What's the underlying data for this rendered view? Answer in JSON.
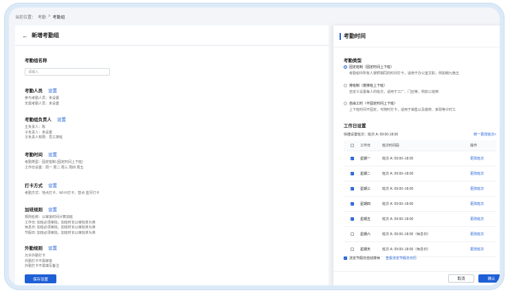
{
  "breadcrumb": {
    "prefix": "当前位置：",
    "items": [
      "考勤",
      "考勤组"
    ],
    "sep": ">"
  },
  "left": {
    "title": "新增考勤组",
    "name_label": "考勤组名称",
    "name_placeholder": "请输入",
    "sections": [
      {
        "title": "考勤人员",
        "link": "设置",
        "lines": [
          "参与考勤人员：未设置",
          "无需考勤人员：未设置"
        ]
      },
      {
        "title": "考勤组负责人",
        "link": "设置",
        "lines": [
          "主负责人：陈",
          "子负责人：未设置",
          "子负责人权限：员工排班"
        ]
      },
      {
        "title": "考勤时间",
        "link": "设置",
        "lines": [
          "考勤类型：固定班制 (固定时间上下班)",
          "工作日设置：周一 周二 周三 周四 周五"
        ]
      },
      {
        "title": "打卡方式",
        "link": "设置",
        "lines": [
          "考勤方式：地点打卡、WI-FI打卡、智点 蓝牙打卡"
        ]
      },
      {
        "title": "加班规则",
        "link": "设置",
        "lines": [
          "规则名称：以审批时间计算加班",
          "工作日: 加班必须审批，加班时长以审批单为准",
          "休息日: 加班必须审批，加班时长以审批单为准",
          "节假日: 加班必须审批，加班时长以审批单为准"
        ]
      },
      {
        "title": "外勤规则",
        "link": "设置",
        "lines": [
          "允许外勤打卡",
          "外勤打卡不需审批",
          "外勤打卡不需填写备注"
        ]
      }
    ],
    "save_label": "保存设置"
  },
  "right": {
    "title": "考勤时间",
    "type_title": "考勤类型",
    "types": [
      {
        "label": "固定班制（固定时间上下班）",
        "desc": "考勤组中所有人按照相同的时间打卡，适用于办公室文职，例如朝九晚五",
        "selected": true
      },
      {
        "label": "排班制（按排班上下班）",
        "desc": "自定义设置每人的班次，适用于工厂、门店等，例如三班倒",
        "selected": false
      },
      {
        "label": "自由工时（不固定时间上下班）",
        "desc": "上下班时间不固定，可随时打卡，适用于销售以及装修、家政等计时工",
        "selected": false
      }
    ],
    "workday_title": "工作日设置",
    "quick_label": "快捷设置班次：班次 A: 09:00-18:00",
    "quick_link": "统一更改班次>",
    "table_headers": {
      "day": "工作日",
      "time": "班次时间段",
      "action": "操作"
    },
    "rows": [
      {
        "day": "星期一",
        "time": "班次 A: 09:00–18:00",
        "action": "更改班次",
        "checked": true
      },
      {
        "day": "星期二",
        "time": "班次 A: 09:00–18:00",
        "action": "更改班次",
        "checked": true
      },
      {
        "day": "星期三",
        "time": "班次 A: 09:00–18:00",
        "action": "更改班次",
        "checked": true
      },
      {
        "day": "星期四",
        "time": "班次 A: 09:00–18:00",
        "action": "更改班次",
        "checked": true
      },
      {
        "day": "星期五",
        "time": "班次 A: 09:00–18:00",
        "action": "更改班次",
        "checked": true
      },
      {
        "day": "星期六",
        "time": "班次 A: 09:00–18:00（休息日）",
        "action": "更改班次",
        "checked": false
      },
      {
        "day": "星期天",
        "time": "班次 A: 09:00–18:00（休息日）",
        "action": "更改班次",
        "checked": false
      }
    ],
    "holiday_label": "法定节假日自动排休",
    "holiday_link": "查看法定节假日日历",
    "cancel_label": "取消",
    "ok_label": "确认"
  },
  "colors": {
    "accent": "#1f5fd6",
    "frame": "#dceaf8"
  }
}
